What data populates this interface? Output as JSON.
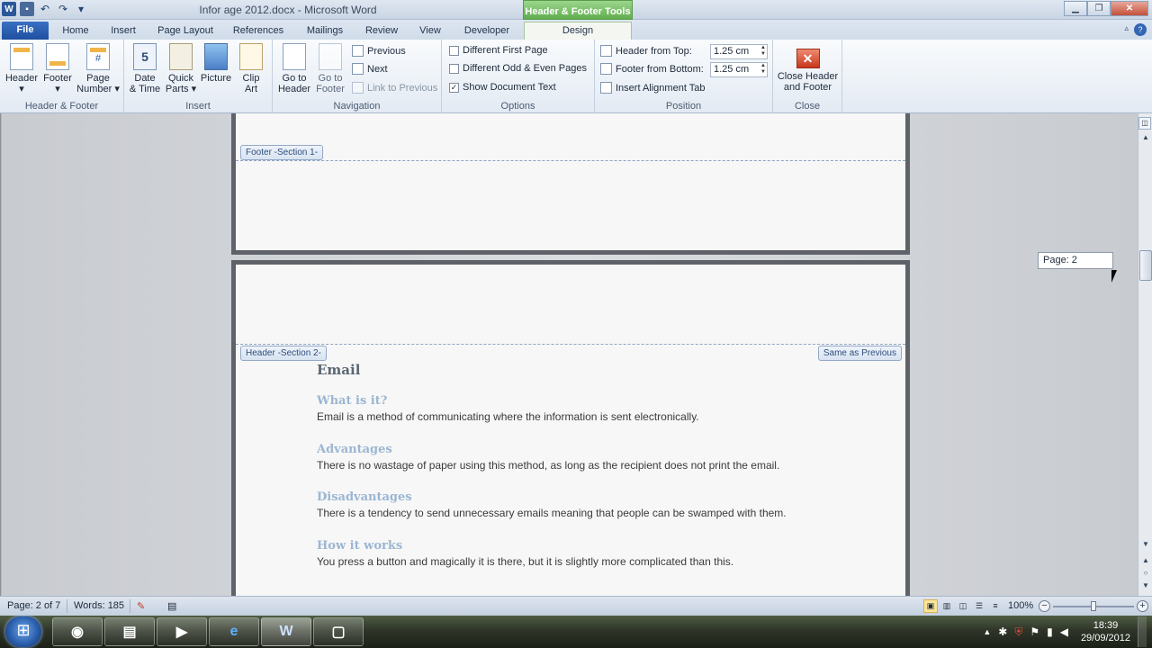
{
  "window": {
    "title": "Infor age 2012.docx - Microsoft Word",
    "controls": {
      "minimize": "▁",
      "restore": "❐",
      "close": "✕"
    }
  },
  "quick_access": {
    "logo": "W",
    "save": "▪",
    "undo": "↶",
    "redo": "↷",
    "customize": "▾"
  },
  "contextual_tab_group": "Header & Footer Tools",
  "tabs": {
    "file": "File",
    "home": "Home",
    "insert": "Insert",
    "page_layout": "Page Layout",
    "references": "References",
    "mailings": "Mailings",
    "review": "Review",
    "view": "View",
    "developer": "Developer",
    "design": "Design"
  },
  "ribbon": {
    "hf_group": {
      "label": "Header & Footer",
      "header": "Header",
      "footer": "Footer",
      "page_number_1": "Page",
      "page_number_2": "Number"
    },
    "insert_group": {
      "label": "Insert",
      "date_1": "Date",
      "date_2": "& Time",
      "date_icon": "5",
      "quick_1": "Quick",
      "quick_2": "Parts",
      "picture": "Picture",
      "clip_1": "Clip",
      "clip_2": "Art"
    },
    "navigation": {
      "label": "Navigation",
      "goto_header_1": "Go to",
      "goto_header_2": "Header",
      "goto_footer_1": "Go to",
      "goto_footer_2": "Footer",
      "previous": "Previous",
      "next": "Next",
      "link_previous": "Link to Previous"
    },
    "options": {
      "label": "Options",
      "different_first": "Different First Page",
      "different_odd_even": "Different Odd & Even Pages",
      "show_document_text": "Show Document Text",
      "check_mark": "✓"
    },
    "position": {
      "label": "Position",
      "header_from_top": "Header from Top:",
      "header_value": "1.25 cm",
      "footer_from_bottom": "Footer from Bottom:",
      "footer_value": "1.25 cm",
      "insert_alignment_tab": "Insert Alignment Tab",
      "spin_up": "▲",
      "spin_down": "▼"
    },
    "close": {
      "label": "Close",
      "close_1": "Close Header",
      "close_2": "and Footer",
      "icon": "✕"
    }
  },
  "document": {
    "footer_tag": "Footer -Section 1-",
    "header_tag": "Header -Section 2-",
    "same_as_previous": "Same as Previous",
    "heading": "Email",
    "sections": [
      {
        "title": "What is it?",
        "body": "Email is a method of communicating where the information is sent electronically."
      },
      {
        "title": "Advantages",
        "body": "There is no wastage of paper using this method, as long as the recipient does not print the email."
      },
      {
        "title": "Disadvantages",
        "body": "There is a tendency to send unnecessary emails meaning that people can be swamped with them."
      },
      {
        "title": "How it works",
        "body": "You press a button and magically it is there, but it is slightly more complicated than this."
      }
    ],
    "page_indicator": "Page: 2"
  },
  "scrollbar": {
    "up": "▲",
    "down": "▼",
    "prev_page": "▲",
    "browse": "○",
    "next_page": "▼",
    "ruler": "◫"
  },
  "statusbar": {
    "page": "Page: 2 of 7",
    "words": "Words: 185",
    "proofing_icon": "✎",
    "macro_icon": "▤",
    "zoom": "100%",
    "zoom_out": "−",
    "zoom_in": "+",
    "zoom_level": 1.0
  },
  "taskbar": {
    "apps": [
      {
        "name": "chrome",
        "glyph": "◉"
      },
      {
        "name": "explorer",
        "glyph": "▤"
      },
      {
        "name": "media",
        "glyph": "▶"
      },
      {
        "name": "ie",
        "glyph": "e"
      },
      {
        "name": "word",
        "glyph": "W"
      },
      {
        "name": "window",
        "glyph": "▢"
      }
    ],
    "tray": {
      "arrow": "▲",
      "time": "18:39",
      "date": "29/09/2012"
    }
  },
  "colors": {
    "ribbon_blue": "#2b579a",
    "context_green": "#5fae4f",
    "heading_blue": "#9bb6d2",
    "close_red": "#c8361b"
  }
}
